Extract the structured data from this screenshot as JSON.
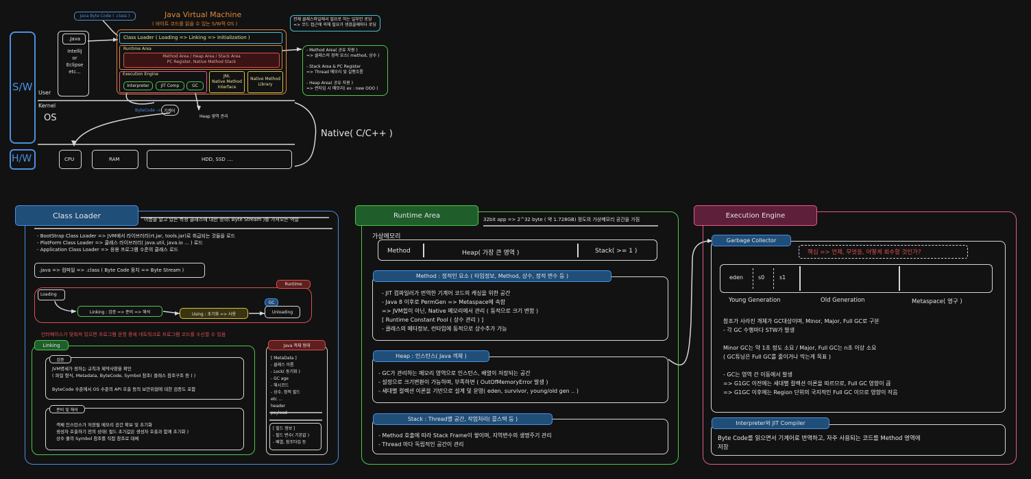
{
  "top": {
    "title": "Java Virtual Machine",
    "subtitle": "( 바이트 코드를 읽을 수 있는 S/W적 OS )",
    "bytecode_tag": "Java Byte Code ( .class )",
    "java_label": ".Java",
    "ide_lines": [
      "IntelliJ",
      "or",
      "Eclipse",
      "etc..."
    ],
    "class_loader": "Class Loader ( Loading => Linking => Initialization )",
    "runtime_area": "Runtime Area",
    "runtime_inner": [
      "Method Area / Heap Area / Stack Area",
      "PC Register, Native Method Stack"
    ],
    "exec_engine": "Execution Engine",
    "interpreter": "Interpreter",
    "jit": "JIT Comp",
    "gc": "GC",
    "jni": [
      "JNI,",
      "Native Method",
      "Interface"
    ],
    "native_lib": [
      "Native Method",
      "Library"
    ],
    "note_top": [
      "전체 클래스파일에서 필요로 하는 일부만 로딩",
      "=> 코드 접근에 의해 필요가 생겼을때마다 로딩"
    ],
    "note_green": [
      "- Method Area( 공유 자원 )",
      "=> 클래스의 정적 요소( method, 상수 )",
      "",
      "- Stack Area & PC Register",
      "=> Thread 메모리 및 실행흐름",
      "",
      "- Heap Area( 공유 자원 )",
      "=> 런타임 시 메모리( ex : new OOO )"
    ],
    "sw": "S/W",
    "hw": "H/W",
    "user": "User",
    "kernel": "Kernel",
    "os": "OS",
    "native": "Native( C/C++ )",
    "bytecode_arrow": "ByteCode ->",
    "machine": "기계어",
    "heap_manage": "Heap 영역 관리",
    "cpu": "CPU",
    "ram": "RAM",
    "hdd": "HDD, SSD ...."
  },
  "class_loader_panel": {
    "title": "Class Loader",
    "desc": "이름을 알고 있는 특정 클래스에 대한 정의( Byte Stream )를 가져오는 역할",
    "bullets": [
      "- BootStrap Class Loader => JVM에서 라이브러리(rt.jar, tools.jar)로 취급되는 것들을 로드",
      "- PlatForm Class Loader => 클래스 라이브러리( java.util, java.io ... ) 로드",
      "- Application Class Loader => 응용 프로그램 수준의 클래스 로드"
    ],
    "compile": ".java => 컴파일 => .class ( Byte Code 뭉치 == Byte Stream )",
    "runtime": "Runtime",
    "loading": "Loading",
    "linking": "Linking : 검증 => 준비 => 해석",
    "using": "Using : 초기화 => 사용",
    "gc": "GC",
    "unloading": "Unloading",
    "warning": "인터페이스가 맞춰져 있으면 프로그램 운영 중에 네트워크로 프로그램 코드를 수신할 수 있음",
    "linking_title": "Linking",
    "verify": "검증",
    "verify_lines": [
      "JVM명세가 정하는 규칙과 제약사항을 확인",
      "( 파일 형식, Metadata, ByteCode, Symbol 참조( 클래스 참조구조 등 ) )",
      "",
      "ByteCode 수준에서 OS 수준의 API 호출 등의 보안위협에 대한 검증도 포함"
    ],
    "prep": "준비 및 해석",
    "prep_lines": [
      "객체 인스턴스가 저장될 메모리 공간 확보 및 초기화",
      "생성자 호출하기 전의 상태( 필드 초기값은 생성자 호출과 함께 초기화 )",
      "상수 풀의 Symbol 참조를 직접 참조로 대체"
    ],
    "obj_title": "Java 객체 형태",
    "obj_lines": [
      "[ MetaData ]",
      "- 클래스 이름",
      "- Lock( 동기화 )",
      "- GC age",
      "- 해시코드",
      "- 상수, 정적 필드",
      "etc ...",
      "header"
    ],
    "obj_payload": "payload",
    "obj_lines2": [
      "[ 필드 정보 ]",
      "- 필드 변수( 기본값 )",
      "- 배열, 참조타입 등"
    ]
  },
  "runtime_panel": {
    "title": "Runtime Area",
    "desc": "32bit app => 2^32 byte ( 약 1.728GB) 정도의 가상메모리 공간을 가짐",
    "vm": "가상메모리",
    "method": "Method",
    "heap": "Heap( 가장 큰 영역 )",
    "stack": "Stack( >= 1 )",
    "method_title": "Method : 정적인 요소 ( 타입정보, Method, 상수, 정적 변수 등 )",
    "method_lines": [
      "- JIT 컴파일러가 번역한 기계어 코드의 캐싱을 위한 공간",
      "- Java 8 이후로 PermGen => Metaspace에 속함",
      "=> JVM힙이 아닌, Native 메모리에서 관리 ( 동적으로 크기 변함 )",
      "[ Runtime Constant Pool ( 상수 관리 ) ]",
      "- 클래스의 메타정보, 런타임에 동적으로 상수추가 가능"
    ],
    "heap_title": "Heap : 인스턴스( Java 객체 )",
    "heap_lines": [
      "- GC가 관리하는 메모리 영역으로 인스턴스, 배열이 저장되는 공간",
      "- 설정으로 크기변환이 가능하며, 부족하면 ( OutOfMemoryError 발생 )",
      "- 세대별 컬렉션 이론을 기반으로 설계 및 운영( eden, survivor, young/old gen .. )"
    ],
    "stack_title": "Stack : Thread별 공간, 작업처리( 콜스택 등 )",
    "stack_lines": [
      "- Method 호출에 따라 Stack Frame이 쌓이며, 지역변수의 생명주기 관리",
      "- Thread 마다 독립적인 공간이 관리"
    ]
  },
  "exec_panel": {
    "title": "Execution Engine",
    "gc_title": "Garbage Collector",
    "gc_note": "핵심 => 언제, 무엇을, 어떻게 회수할 것인가?",
    "eden": "eden",
    "s0": "s0",
    "s1": "s1",
    "young": "Young Generation",
    "old": "Old Generation",
    "meta": "Metaspace( 영구 )",
    "gc_lines": [
      "참조가 사라진 개체가 GC대상이며, Minor, Major, Full GC로 구분",
      "- 각 GC 수행마다 STW가 발생",
      "",
      "Minor GC는 약 1초 정도 소요 / Major, Full GC는 n초 이상 소요",
      "( GC튜닝은 Full GC를 줄이거나 막는게 목표 )",
      "",
      "- GC는 영역 간 이동에서 발생",
      "=> G1GC 이전에는 세대별 컬렉션 이론을 따르므로, Full GC 영향이 큼",
      "=> G1GC 이후에는 Region 단위의 국지적인 Full GC 이므로 영향이 작음"
    ],
    "jit_title": "Interpreter와 JIT Compiler",
    "jit_lines": [
      "Byte Code를 읽으면서 기계어로 번역하고, 자주 사용되는 코드를 Method 영역에",
      "저장"
    ]
  },
  "colors": {
    "blue": "#4a90e2",
    "orange": "#e0873a",
    "green": "#4ec94e",
    "pink": "#e85a8a",
    "red": "#e05050",
    "yellow": "#d8c040",
    "cyan": "#4ac0d8",
    "header_blue": "#1f4e79",
    "header_green": "#1f5e2a",
    "header_pink": "#5e1f3a"
  }
}
